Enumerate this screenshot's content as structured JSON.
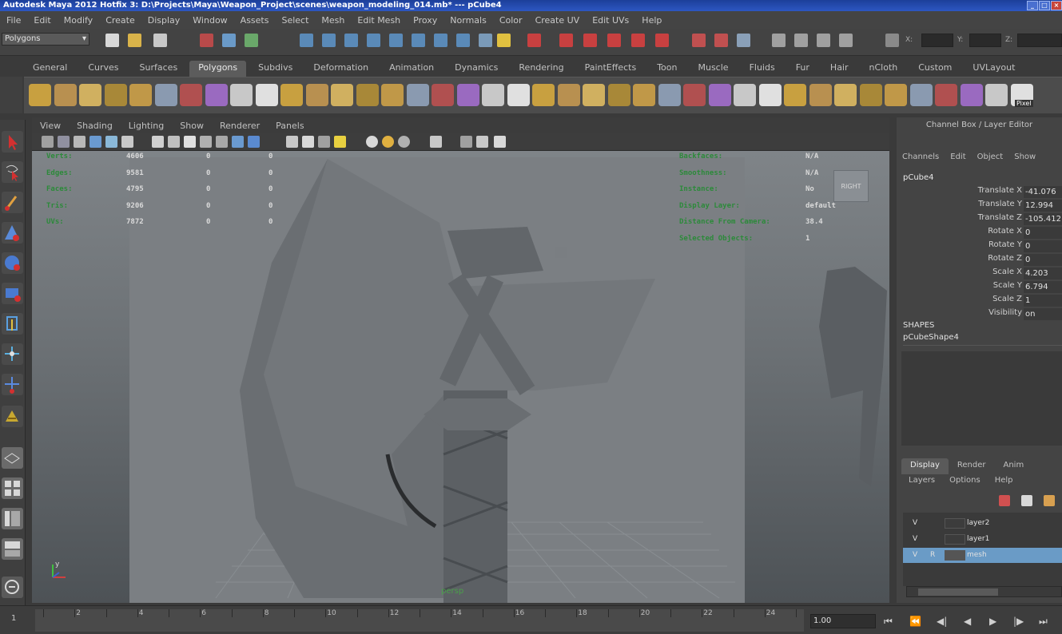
{
  "title_bar": {
    "title": "Autodesk Maya 2012 Hotfix 3: D:\\Projects\\Maya\\Weapon_Project\\scenes\\weapon_modeling_014.mb* --- pCube4"
  },
  "menu_bar": {
    "items": [
      "File",
      "Edit",
      "Modify",
      "Create",
      "Display",
      "Window",
      "Assets",
      "Select",
      "Mesh",
      "Edit Mesh",
      "Proxy",
      "Normals",
      "Color",
      "Create UV",
      "Edit UVs",
      "Help"
    ]
  },
  "status_line": {
    "mode": "Polygons",
    "coord_labels": [
      "X:",
      "Y:",
      "Z:"
    ]
  },
  "shelf_tabs": {
    "items": [
      "General",
      "Curves",
      "Surfaces",
      "Polygons",
      "Subdivs",
      "Deformation",
      "Animation",
      "Dynamics",
      "Rendering",
      "PaintEffects",
      "Toon",
      "Muscle",
      "Fluids",
      "Fur",
      "Hair",
      "nCloth",
      "Custom",
      "UVLayout"
    ],
    "active": "Polygons"
  },
  "shelf": {
    "icons": [
      "sphere",
      "cube",
      "cylinder",
      "cone",
      "plane",
      "torus",
      "prism",
      "pipe",
      "helix",
      "combine",
      "separate",
      "extract",
      "smooth",
      "boolean",
      "mirror",
      "fill-hole",
      "bridge",
      "extrude",
      "append",
      "split",
      "insert-loop",
      "offset-loop",
      "bevel",
      "merge",
      "collapse",
      "wedge",
      "poke",
      "multi-cut",
      "checker",
      "uv-snapshot",
      "uv-map",
      "poly-count",
      "sculpt",
      "reduce",
      "triangulate",
      "quadrangulate",
      "unfold",
      "layout",
      "fixed-cam",
      "unknown"
    ],
    "last_label": "Pixel"
  },
  "panel_menu": {
    "items": [
      "View",
      "Shading",
      "Lighting",
      "Show",
      "Renderer",
      "Panels"
    ]
  },
  "hud": {
    "left": [
      {
        "label": "Verts:",
        "v1": "4606",
        "v2": "0",
        "v3": "0"
      },
      {
        "label": "Edges:",
        "v1": "9581",
        "v2": "0",
        "v3": "0"
      },
      {
        "label": "Faces:",
        "v1": "4795",
        "v2": "0",
        "v3": "0"
      },
      {
        "label": "Tris:",
        "v1": "9206",
        "v2": "0",
        "v3": "0"
      },
      {
        "label": "UVs:",
        "v1": "7872",
        "v2": "0",
        "v3": "0"
      }
    ],
    "right": [
      {
        "label": "Backfaces:",
        "value": "N/A"
      },
      {
        "label": "Smoothness:",
        "value": "N/A"
      },
      {
        "label": "Instance:",
        "value": "No"
      },
      {
        "label": "Display Layer:",
        "value": "default"
      },
      {
        "label": "Distance From Camera:",
        "value": "38.4"
      },
      {
        "label": "Selected Objects:",
        "value": "1"
      }
    ],
    "view_cube_label": "RIGHT",
    "camera_label": "persp"
  },
  "channel_box": {
    "title": "Channel Box / Layer Editor",
    "menu": [
      "Channels",
      "Edit",
      "Object",
      "Show"
    ],
    "object_name": "pCube4",
    "attributes": [
      {
        "name": "Translate X",
        "value": "-41.076"
      },
      {
        "name": "Translate Y",
        "value": "12.994"
      },
      {
        "name": "Translate Z",
        "value": "-105.412"
      },
      {
        "name": "Rotate X",
        "value": "0"
      },
      {
        "name": "Rotate Y",
        "value": "0"
      },
      {
        "name": "Rotate Z",
        "value": "0"
      },
      {
        "name": "Scale X",
        "value": "4.203"
      },
      {
        "name": "Scale Y",
        "value": "6.794"
      },
      {
        "name": "Scale Z",
        "value": "1"
      },
      {
        "name": "Visibility",
        "value": "on"
      }
    ],
    "shapes_header": "SHAPES",
    "shape_name": "pCubeShape4"
  },
  "layer_editor": {
    "tabs": [
      "Display",
      "Render",
      "Anim"
    ],
    "active_tab": "Display",
    "menu": [
      "Layers",
      "Options",
      "Help"
    ],
    "layers": [
      {
        "visibility": "V",
        "ref": "",
        "name": "layer2",
        "selected": false
      },
      {
        "visibility": "V",
        "ref": "",
        "name": "layer1",
        "selected": false
      },
      {
        "visibility": "V",
        "ref": "R",
        "name": "mesh",
        "selected": true
      }
    ]
  },
  "timeline": {
    "tick_labels": [
      "2",
      "4",
      "6",
      "8",
      "10",
      "12",
      "14",
      "16",
      "18",
      "20",
      "22",
      "24"
    ],
    "current_frame": "1.00",
    "start_label": "1"
  },
  "colors": {
    "title_bar": "#2d57c2",
    "hud_label": "#2c8a3a",
    "selected_layer": "#6a9bc6"
  }
}
